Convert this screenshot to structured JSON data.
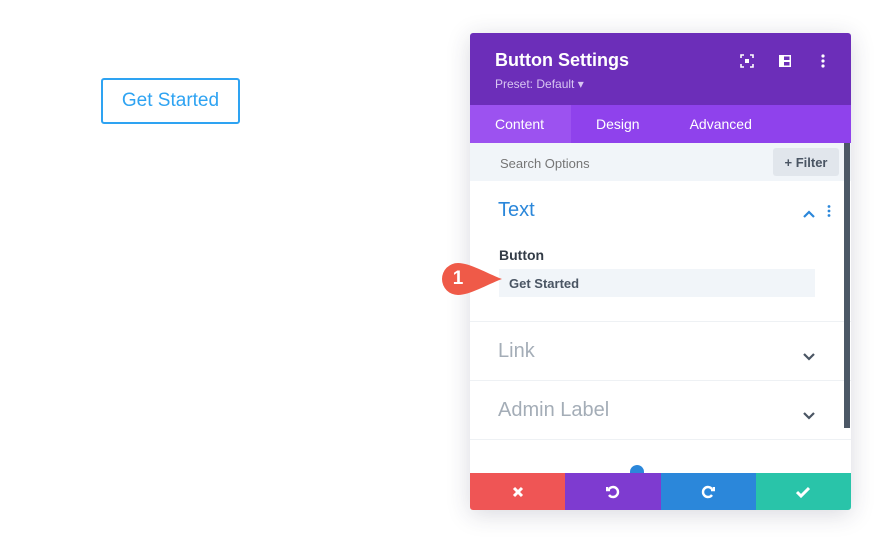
{
  "page": {
    "button_label": "Get Started"
  },
  "modal": {
    "title": "Button Settings",
    "preset": "Preset: Default ▾",
    "header_icons": [
      "focus-icon",
      "split-view-icon",
      "more-options-icon"
    ],
    "tabs": [
      {
        "label": "Content",
        "active": true
      },
      {
        "label": "Design",
        "active": false
      },
      {
        "label": "Advanced",
        "active": false
      }
    ],
    "search": {
      "placeholder": "Search Options"
    },
    "filter_label": "+ Filter",
    "sections": [
      {
        "title": "Text",
        "open": true,
        "field_label": "Button",
        "field_value": "Get Started"
      },
      {
        "title": "Link",
        "open": false
      },
      {
        "title": "Admin Label",
        "open": false
      }
    ],
    "footer": {
      "cancel_color": "#ef5555",
      "undo_color": "#7e3bd0",
      "redo_color": "#2b87da",
      "save_color": "#29c4a9"
    }
  },
  "annotation": {
    "badge_number": "1",
    "badge_color": "#ef5a48"
  },
  "colors": {
    "header": "#6c2eb9",
    "tabs": "#8f42ec",
    "accent": "#2ea3f2"
  }
}
